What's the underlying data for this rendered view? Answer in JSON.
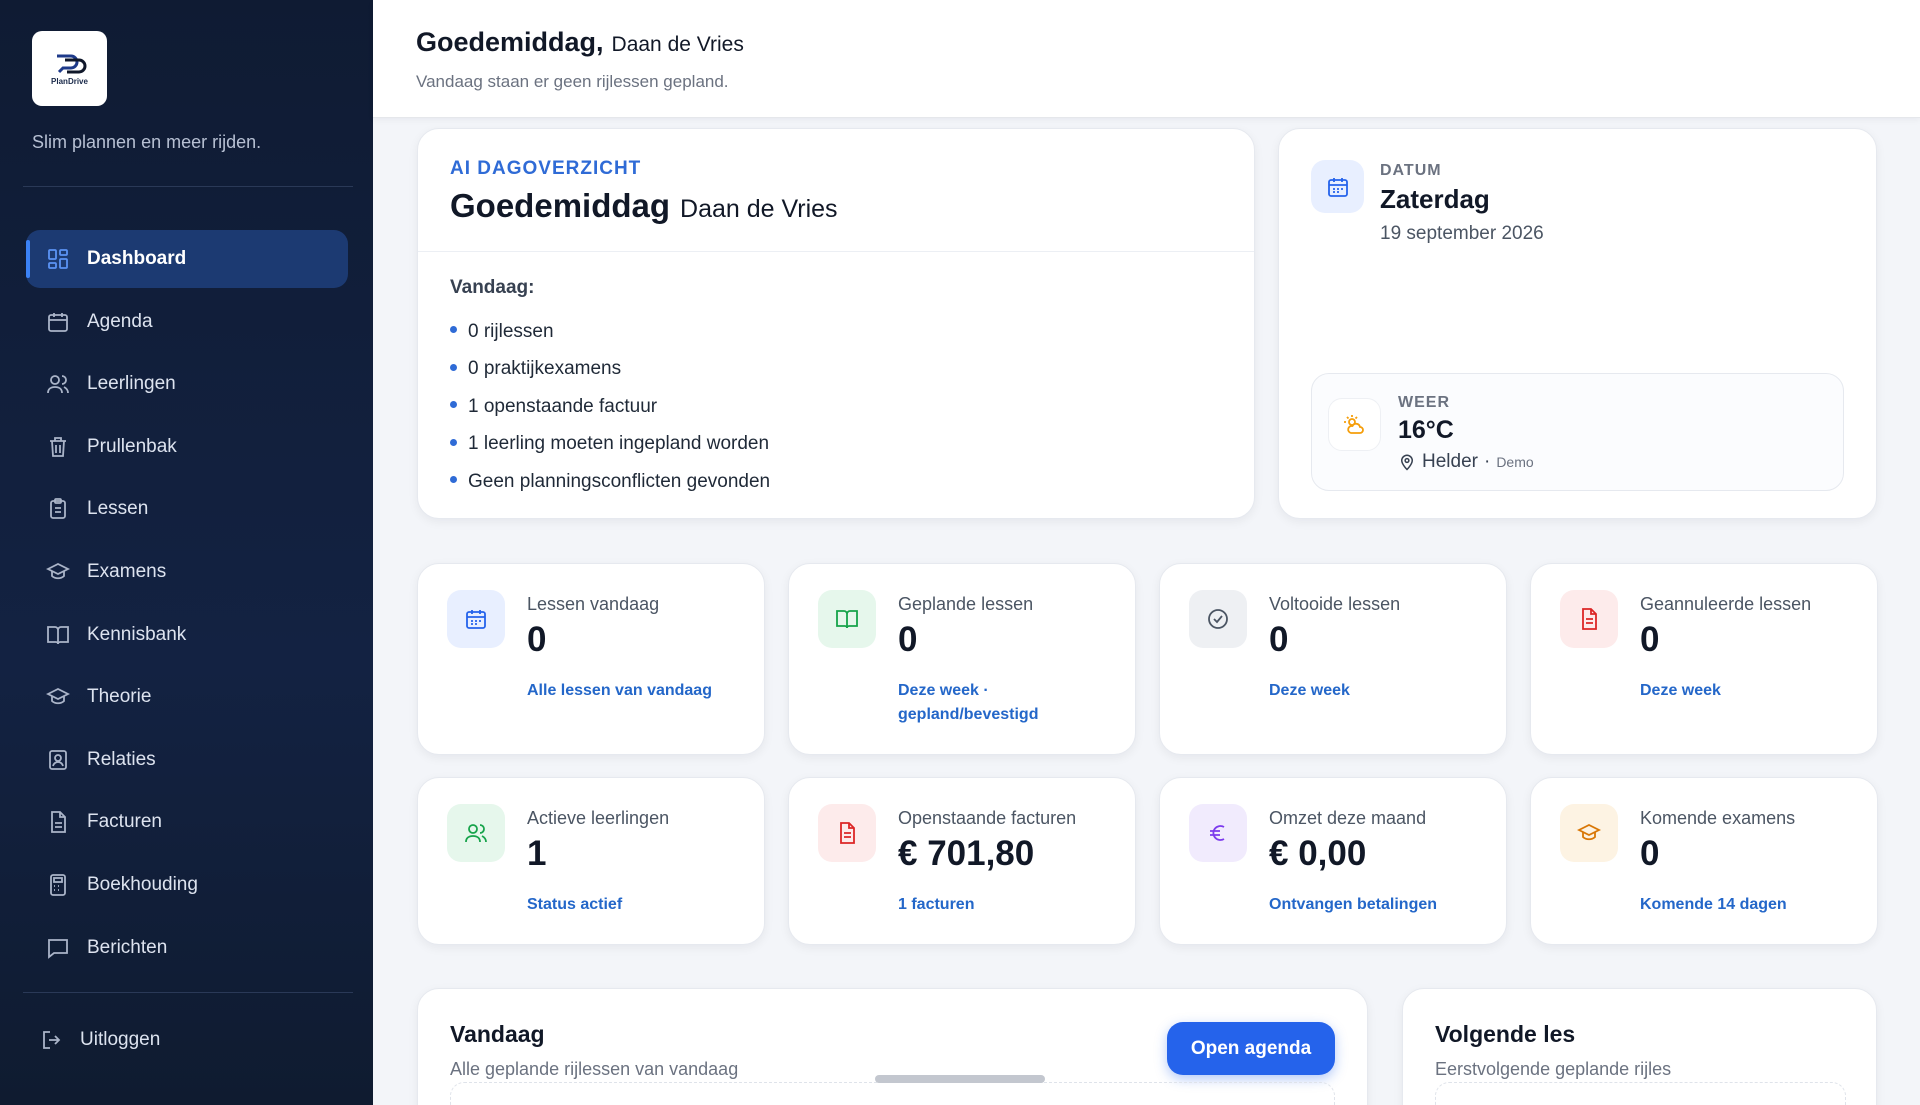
{
  "sidebar": {
    "logo_text": "PlanDrive",
    "tagline": "Slim plannen en meer rijden.",
    "items": [
      {
        "label": "Dashboard",
        "icon": "grid-icon"
      },
      {
        "label": "Agenda",
        "icon": "calendar-icon"
      },
      {
        "label": "Leerlingen",
        "icon": "users-icon"
      },
      {
        "label": "Prullenbak",
        "icon": "trash-icon"
      },
      {
        "label": "Lessen",
        "icon": "clipboard-icon"
      },
      {
        "label": "Examens",
        "icon": "graduation-cap-icon"
      },
      {
        "label": "Kennisbank",
        "icon": "book-icon"
      },
      {
        "label": "Theorie",
        "icon": "graduation-cap-icon"
      },
      {
        "label": "Relaties",
        "icon": "contact-icon"
      },
      {
        "label": "Facturen",
        "icon": "file-icon"
      },
      {
        "label": "Boekhouding",
        "icon": "calculator-icon"
      },
      {
        "label": "Berichten",
        "icon": "message-icon"
      }
    ],
    "logout": "Uitloggen"
  },
  "header": {
    "greeting": "Goedemiddag,",
    "name": "Daan de Vries",
    "subtitle": "Vandaag staan er geen rijlessen gepland."
  },
  "ai": {
    "label": "AI DAGOVERZICHT",
    "greeting": "Goedemiddag",
    "name": "Daan de Vries",
    "today_label": "Vandaag:",
    "items": [
      "0 rijlessen",
      "0 praktijkexamens",
      "1 openstaande factuur",
      "1 leerling moeten ingepland worden",
      "Geen planningsconflicten gevonden"
    ]
  },
  "date": {
    "label": "DATUM",
    "day": "Zaterdag",
    "full": "19 september 2026"
  },
  "weather": {
    "label": "WEER",
    "temp": "16°C",
    "condition": "Helder",
    "separator": "·",
    "source": "Demo"
  },
  "stats": [
    {
      "title": "Lessen vandaag",
      "value": "0",
      "link": "Alle lessen van vandaag",
      "icon": "calendar-icon",
      "color": "#2563eb",
      "bg": "#e8efff"
    },
    {
      "title": "Geplande lessen",
      "value": "0",
      "link": "Deze week · gepland/bevestigd",
      "icon": "book-open-icon",
      "color": "#16a34a",
      "bg": "#e6f7ec"
    },
    {
      "title": "Voltooide lessen",
      "value": "0",
      "link": "Deze week",
      "icon": "check-circle-icon",
      "color": "#4b5563",
      "bg": "#eef0f3"
    },
    {
      "title": "Geannuleerde lessen",
      "value": "0",
      "link": "Deze week",
      "icon": "file-x-icon",
      "color": "#dc2626",
      "bg": "#fdebeb"
    },
    {
      "title": "Actieve leerlingen",
      "value": "1",
      "link": "Status actief",
      "icon": "users-icon",
      "color": "#16a34a",
      "bg": "#e6f7ec"
    },
    {
      "title": "Openstaande facturen",
      "value": "€ 701,80",
      "link": "1 facturen",
      "icon": "file-text-icon",
      "color": "#dc2626",
      "bg": "#fdebeb"
    },
    {
      "title": "Omzet deze maand",
      "value": "€ 0,00",
      "link": "Ontvangen betalingen",
      "icon": "euro-icon",
      "color": "#7c3aed",
      "bg": "#f1ebfd"
    },
    {
      "title": "Komende examens",
      "value": "0",
      "link": "Komende 14 dagen",
      "icon": "graduation-cap-icon",
      "color": "#d97706",
      "bg": "#fdf3e3"
    }
  ],
  "today_panel": {
    "title": "Vandaag",
    "subtitle": "Alle geplande rijlessen van vandaag",
    "button": "Open agenda"
  },
  "next_panel": {
    "title": "Volgende les",
    "subtitle": "Eerstvolgende geplande rijles"
  }
}
